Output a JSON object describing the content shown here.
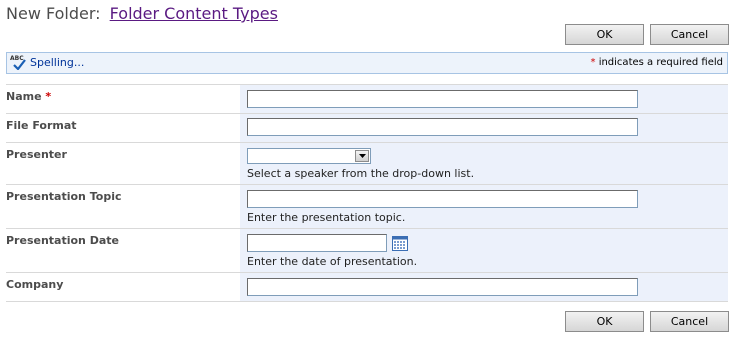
{
  "header": {
    "prefix": "New Folder:",
    "link": "Folder Content Types"
  },
  "buttons": {
    "ok": "OK",
    "cancel": "Cancel"
  },
  "toolbar": {
    "spelling": "Spelling...",
    "required_star": "*",
    "required_note": " indicates a required field"
  },
  "form": {
    "name": {
      "label": "Name",
      "required": "*",
      "value": ""
    },
    "file_format": {
      "label": "File Format",
      "value": ""
    },
    "presenter": {
      "label": "Presenter",
      "value": "",
      "description": "Select a speaker from the drop-down list."
    },
    "topic": {
      "label": "Presentation Topic",
      "value": "",
      "description": "Enter the presentation topic."
    },
    "date": {
      "label": "Presentation Date",
      "value": "",
      "description": "Enter the date of presentation."
    },
    "company": {
      "label": "Company",
      "value": ""
    }
  },
  "colors": {
    "field_background": "#ecf1fb",
    "toolbar_background": "#edf3fb",
    "link": "#5a1a82",
    "required": "#cc0000"
  },
  "icons": {
    "spelling": "spell-check-icon",
    "calendar": "calendar-icon",
    "dropdown": "chevron-down-icon"
  }
}
